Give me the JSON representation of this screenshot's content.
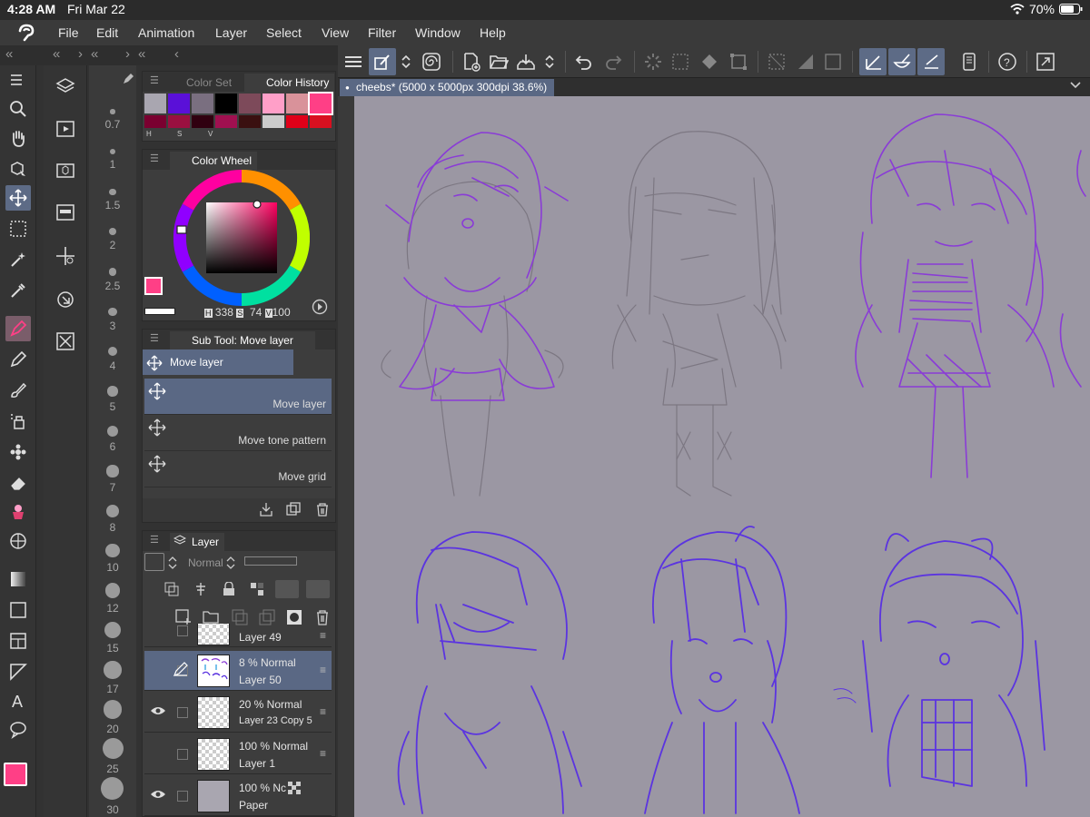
{
  "status": {
    "time": "4:28 AM",
    "date": "Fri Mar 22",
    "battery": "70%"
  },
  "menu": [
    "File",
    "Edit",
    "Animation",
    "Layer",
    "Select",
    "View",
    "Filter",
    "Window",
    "Help"
  ],
  "document": {
    "tab_label": "cheebs* (5000 x 5000px 300dpi 38.6%)"
  },
  "color_set_panel": {
    "tab_color_set": "Color Set",
    "tab_color_history": "Color History",
    "swatches_row1": [
      "#a9a6b0",
      "#5a10d8",
      "#7a6f80",
      "#000000",
      "#7d4a5a",
      "#ff9fc8",
      "#d9929a",
      "#ff3f86"
    ],
    "swatches_row2": [
      "#7a0030",
      "#9a1040",
      "#300010",
      "#a01050",
      "#3a1010",
      "#cccccc",
      "#e00018",
      "#d81020"
    ],
    "letters": [
      "H",
      "S",
      "V"
    ]
  },
  "color_wheel_panel": {
    "title": "Color Wheel",
    "h_label": "H",
    "h_value": "338",
    "s_label": "S",
    "s_value": "74",
    "v_label": "V",
    "v_value": "100",
    "main_color": "#ff3f86"
  },
  "sub_tool_panel": {
    "title": "Sub Tool: Move layer",
    "group_label": "Move layer",
    "items": [
      {
        "label": "Move layer"
      },
      {
        "label": "Move tone pattern"
      },
      {
        "label": "Move grid"
      }
    ]
  },
  "layer_panel": {
    "title": "Layer",
    "blend_mode": "Normal",
    "layers": [
      {
        "opacity": "",
        "name": "Layer 49",
        "visible": false
      },
      {
        "opacity": "8 %  Normal",
        "name": "Layer 50",
        "visible": false
      },
      {
        "opacity": "20 %  Normal",
        "name": "Layer 23 Copy 5",
        "visible": true
      },
      {
        "opacity": "100 %  Normal",
        "name": "Layer 1",
        "visible": false
      },
      {
        "opacity": "100 %  Nc",
        "name": "Paper",
        "visible": true
      }
    ]
  },
  "brush_sizes": [
    "0.7",
    "1",
    "1.5",
    "2",
    "2.5",
    "3",
    "4",
    "5",
    "6",
    "7",
    "8",
    "10",
    "12",
    "15",
    "17",
    "20",
    "25",
    "30"
  ],
  "colors": {
    "accent": "#5d6b86",
    "canvas": "#9b97a3",
    "sketch_purple": "#8a3cd6",
    "sketch_gray": "#7c7782",
    "sketch_blue": "#5b34e0"
  }
}
